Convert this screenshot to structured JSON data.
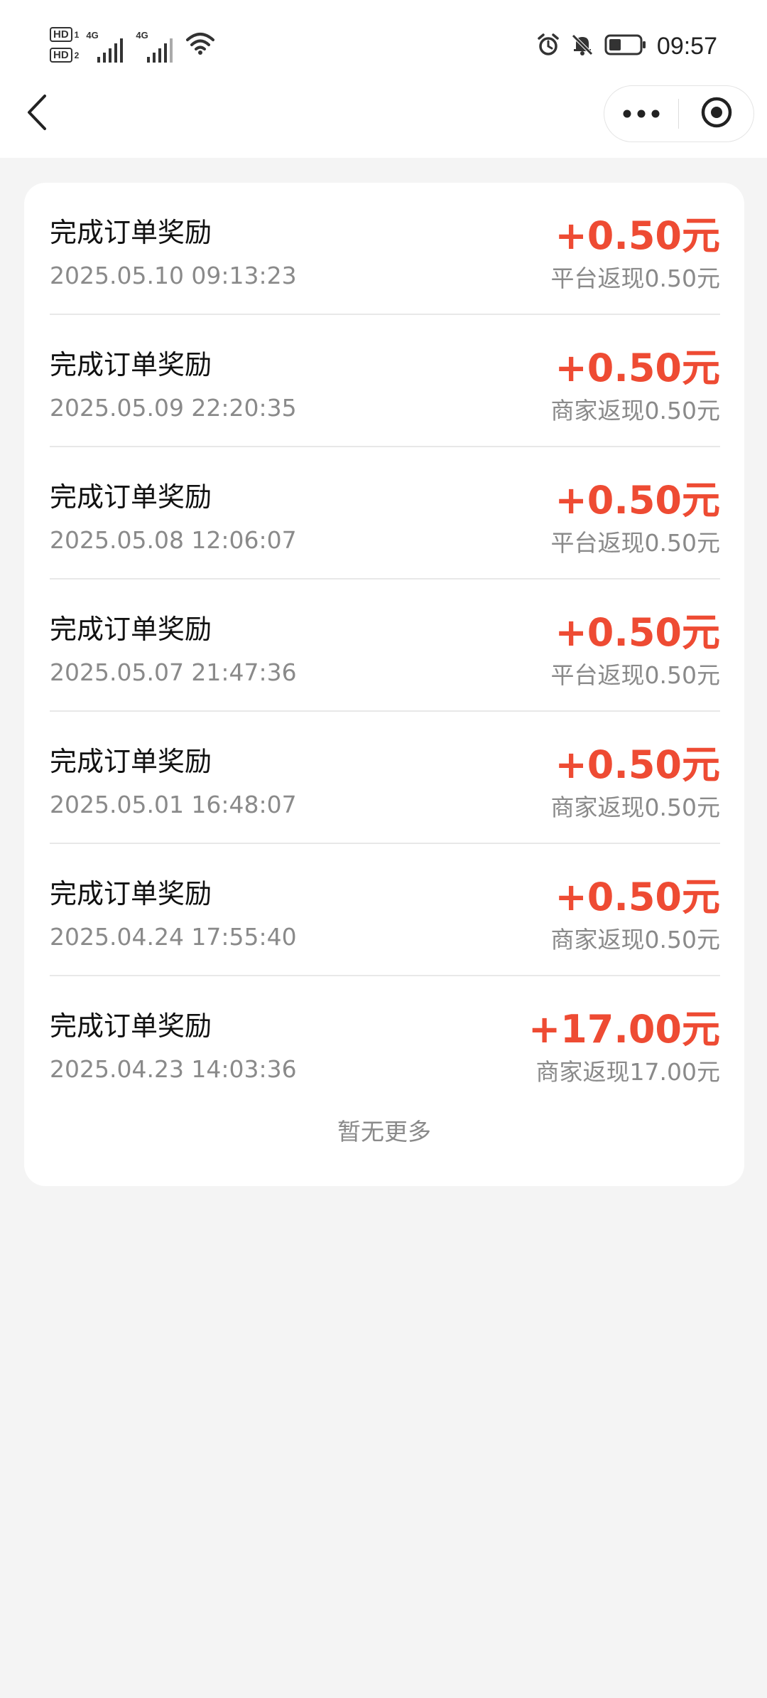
{
  "status_bar": {
    "time": "09:57",
    "sim1_label": "HD",
    "sim1_num": "1",
    "sim2_label": "HD",
    "sim2_num": "2",
    "network1": "4G",
    "network2": "4G",
    "battery_level": 0.4,
    "icons": [
      "alarm-icon",
      "mute-bell-icon",
      "battery-icon",
      "wifi-icon",
      "signal-icon"
    ]
  },
  "nav": {
    "back_icon": "chevron-left-icon",
    "more_icon": "more-dots-icon",
    "close_icon": "target-circle-icon"
  },
  "records": [
    {
      "title": "完成订单奖励",
      "time": "2025.05.10 09:13:23",
      "amount": "+0.50元",
      "desc": "平台返现0.50元"
    },
    {
      "title": "完成订单奖励",
      "time": "2025.05.09 22:20:35",
      "amount": "+0.50元",
      "desc": "商家返现0.50元"
    },
    {
      "title": "完成订单奖励",
      "time": "2025.05.08 12:06:07",
      "amount": "+0.50元",
      "desc": "平台返现0.50元"
    },
    {
      "title": "完成订单奖励",
      "time": "2025.05.07 21:47:36",
      "amount": "+0.50元",
      "desc": "平台返现0.50元"
    },
    {
      "title": "完成订单奖励",
      "time": "2025.05.01 16:48:07",
      "amount": "+0.50元",
      "desc": "商家返现0.50元"
    },
    {
      "title": "完成订单奖励",
      "time": "2025.04.24 17:55:40",
      "amount": "+0.50元",
      "desc": "商家返现0.50元"
    },
    {
      "title": "完成订单奖励",
      "time": "2025.04.23 14:03:36",
      "amount": "+17.00元",
      "desc": "商家返现17.00元"
    }
  ],
  "footer": {
    "no_more": "暂无更多"
  },
  "colors": {
    "accent": "#ee4b33",
    "muted_text": "#8a8a8a",
    "page_bg": "#f4f4f4",
    "card_bg": "#ffffff"
  }
}
